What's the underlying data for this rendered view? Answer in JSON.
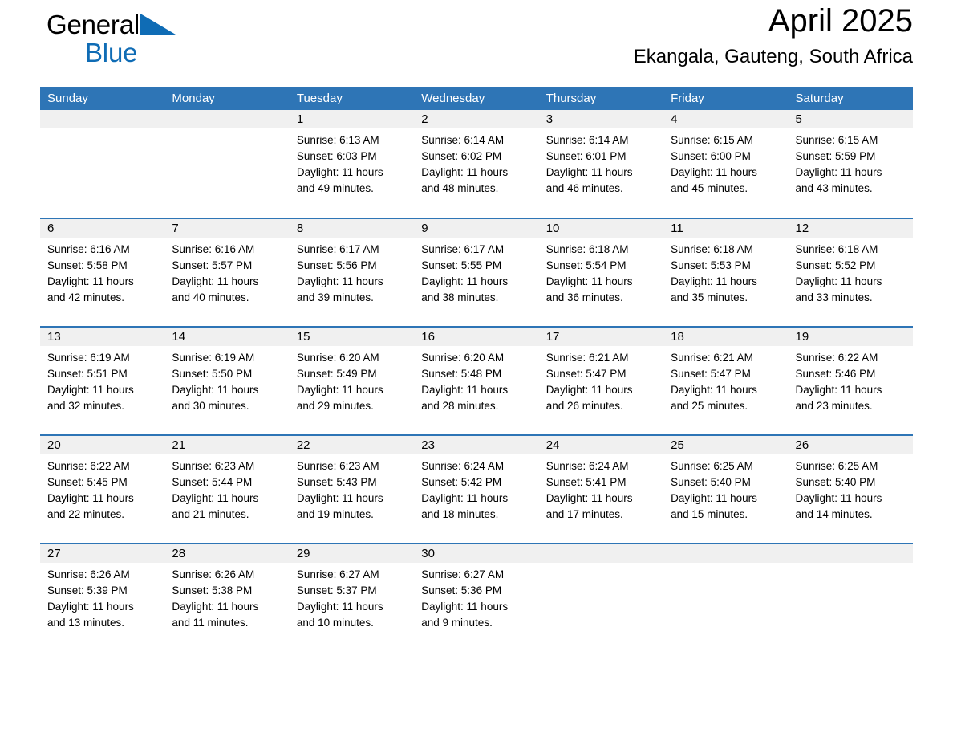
{
  "brand": {
    "name_part1": "General",
    "name_part2": "Blue",
    "triangle_color": "#0f6cb5",
    "logo_icon": "general-blue-triangle-icon"
  },
  "header": {
    "title": "April 2025",
    "location": "Ekangala, Gauteng, South Africa"
  },
  "theme": {
    "header_blue": "#2e75b6",
    "daynum_grey": "#f0f0f0",
    "text_black": "#000000",
    "brand_blue": "#0f6cb5"
  },
  "calendar": {
    "weekday_headers": [
      "Sunday",
      "Monday",
      "Tuesday",
      "Wednesday",
      "Thursday",
      "Friday",
      "Saturday"
    ],
    "weeks": [
      [
        {
          "day": "",
          "lines": []
        },
        {
          "day": "",
          "lines": []
        },
        {
          "day": "1",
          "lines": [
            "Sunrise: 6:13 AM",
            "Sunset: 6:03 PM",
            "Daylight: 11 hours",
            "and 49 minutes."
          ]
        },
        {
          "day": "2",
          "lines": [
            "Sunrise: 6:14 AM",
            "Sunset: 6:02 PM",
            "Daylight: 11 hours",
            "and 48 minutes."
          ]
        },
        {
          "day": "3",
          "lines": [
            "Sunrise: 6:14 AM",
            "Sunset: 6:01 PM",
            "Daylight: 11 hours",
            "and 46 minutes."
          ]
        },
        {
          "day": "4",
          "lines": [
            "Sunrise: 6:15 AM",
            "Sunset: 6:00 PM",
            "Daylight: 11 hours",
            "and 45 minutes."
          ]
        },
        {
          "day": "5",
          "lines": [
            "Sunrise: 6:15 AM",
            "Sunset: 5:59 PM",
            "Daylight: 11 hours",
            "and 43 minutes."
          ]
        }
      ],
      [
        {
          "day": "6",
          "lines": [
            "Sunrise: 6:16 AM",
            "Sunset: 5:58 PM",
            "Daylight: 11 hours",
            "and 42 minutes."
          ]
        },
        {
          "day": "7",
          "lines": [
            "Sunrise: 6:16 AM",
            "Sunset: 5:57 PM",
            "Daylight: 11 hours",
            "and 40 minutes."
          ]
        },
        {
          "day": "8",
          "lines": [
            "Sunrise: 6:17 AM",
            "Sunset: 5:56 PM",
            "Daylight: 11 hours",
            "and 39 minutes."
          ]
        },
        {
          "day": "9",
          "lines": [
            "Sunrise: 6:17 AM",
            "Sunset: 5:55 PM",
            "Daylight: 11 hours",
            "and 38 minutes."
          ]
        },
        {
          "day": "10",
          "lines": [
            "Sunrise: 6:18 AM",
            "Sunset: 5:54 PM",
            "Daylight: 11 hours",
            "and 36 minutes."
          ]
        },
        {
          "day": "11",
          "lines": [
            "Sunrise: 6:18 AM",
            "Sunset: 5:53 PM",
            "Daylight: 11 hours",
            "and 35 minutes."
          ]
        },
        {
          "day": "12",
          "lines": [
            "Sunrise: 6:18 AM",
            "Sunset: 5:52 PM",
            "Daylight: 11 hours",
            "and 33 minutes."
          ]
        }
      ],
      [
        {
          "day": "13",
          "lines": [
            "Sunrise: 6:19 AM",
            "Sunset: 5:51 PM",
            "Daylight: 11 hours",
            "and 32 minutes."
          ]
        },
        {
          "day": "14",
          "lines": [
            "Sunrise: 6:19 AM",
            "Sunset: 5:50 PM",
            "Daylight: 11 hours",
            "and 30 minutes."
          ]
        },
        {
          "day": "15",
          "lines": [
            "Sunrise: 6:20 AM",
            "Sunset: 5:49 PM",
            "Daylight: 11 hours",
            "and 29 minutes."
          ]
        },
        {
          "day": "16",
          "lines": [
            "Sunrise: 6:20 AM",
            "Sunset: 5:48 PM",
            "Daylight: 11 hours",
            "and 28 minutes."
          ]
        },
        {
          "day": "17",
          "lines": [
            "Sunrise: 6:21 AM",
            "Sunset: 5:47 PM",
            "Daylight: 11 hours",
            "and 26 minutes."
          ]
        },
        {
          "day": "18",
          "lines": [
            "Sunrise: 6:21 AM",
            "Sunset: 5:47 PM",
            "Daylight: 11 hours",
            "and 25 minutes."
          ]
        },
        {
          "day": "19",
          "lines": [
            "Sunrise: 6:22 AM",
            "Sunset: 5:46 PM",
            "Daylight: 11 hours",
            "and 23 minutes."
          ]
        }
      ],
      [
        {
          "day": "20",
          "lines": [
            "Sunrise: 6:22 AM",
            "Sunset: 5:45 PM",
            "Daylight: 11 hours",
            "and 22 minutes."
          ]
        },
        {
          "day": "21",
          "lines": [
            "Sunrise: 6:23 AM",
            "Sunset: 5:44 PM",
            "Daylight: 11 hours",
            "and 21 minutes."
          ]
        },
        {
          "day": "22",
          "lines": [
            "Sunrise: 6:23 AM",
            "Sunset: 5:43 PM",
            "Daylight: 11 hours",
            "and 19 minutes."
          ]
        },
        {
          "day": "23",
          "lines": [
            "Sunrise: 6:24 AM",
            "Sunset: 5:42 PM",
            "Daylight: 11 hours",
            "and 18 minutes."
          ]
        },
        {
          "day": "24",
          "lines": [
            "Sunrise: 6:24 AM",
            "Sunset: 5:41 PM",
            "Daylight: 11 hours",
            "and 17 minutes."
          ]
        },
        {
          "day": "25",
          "lines": [
            "Sunrise: 6:25 AM",
            "Sunset: 5:40 PM",
            "Daylight: 11 hours",
            "and 15 minutes."
          ]
        },
        {
          "day": "26",
          "lines": [
            "Sunrise: 6:25 AM",
            "Sunset: 5:40 PM",
            "Daylight: 11 hours",
            "and 14 minutes."
          ]
        }
      ],
      [
        {
          "day": "27",
          "lines": [
            "Sunrise: 6:26 AM",
            "Sunset: 5:39 PM",
            "Daylight: 11 hours",
            "and 13 minutes."
          ]
        },
        {
          "day": "28",
          "lines": [
            "Sunrise: 6:26 AM",
            "Sunset: 5:38 PM",
            "Daylight: 11 hours",
            "and 11 minutes."
          ]
        },
        {
          "day": "29",
          "lines": [
            "Sunrise: 6:27 AM",
            "Sunset: 5:37 PM",
            "Daylight: 11 hours",
            "and 10 minutes."
          ]
        },
        {
          "day": "30",
          "lines": [
            "Sunrise: 6:27 AM",
            "Sunset: 5:36 PM",
            "Daylight: 11 hours",
            "and 9 minutes."
          ]
        },
        {
          "day": "",
          "lines": []
        },
        {
          "day": "",
          "lines": []
        },
        {
          "day": "",
          "lines": []
        }
      ]
    ]
  }
}
